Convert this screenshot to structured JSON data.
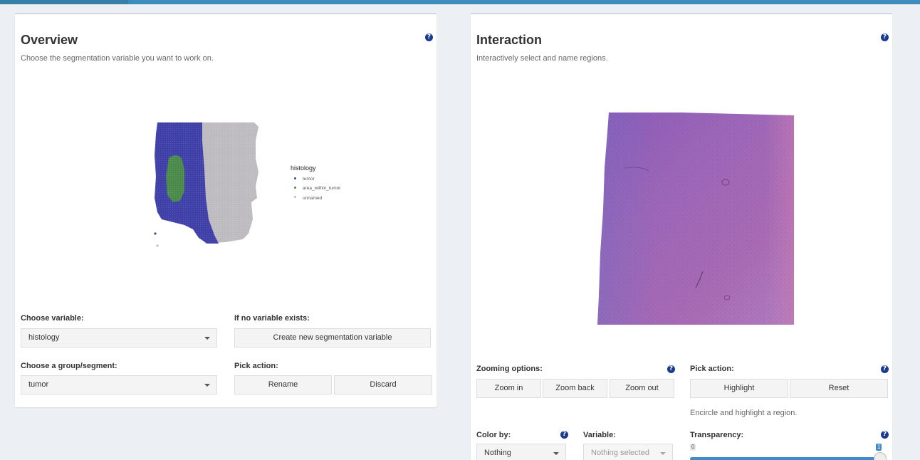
{
  "overview": {
    "title": "Overview",
    "description": "Choose the segmentation variable you want to work on.",
    "help_icon": "?",
    "legend": {
      "title": "histology",
      "items": [
        {
          "label": "tumor",
          "color": "#3f3fa8"
        },
        {
          "label": "area_within_tumor",
          "color": "#4a8a4a"
        },
        {
          "label": "unnamed",
          "color": "#bdbbc0"
        }
      ]
    },
    "choose_variable_label": "Choose variable:",
    "choose_variable_value": "histology",
    "no_variable_label": "If no variable exists:",
    "create_button": "Create new segmentation variable",
    "group_label": "Choose a group/segment:",
    "group_value": "tumor",
    "pick_action_label": "Pick action:",
    "rename_button": "Rename",
    "discard_button": "Discard"
  },
  "interaction": {
    "title": "Interaction",
    "description": "Interactively select and name regions.",
    "help_icon": "?",
    "zoom_label": "Zooming options:",
    "zoom_in": "Zoom in",
    "zoom_back": "Zoom back",
    "zoom_out": "Zoom out",
    "pick_action_label": "Pick action:",
    "highlight_button": "Highlight",
    "reset_button": "Reset",
    "hint": "Encircle and highlight a region.",
    "color_by_label": "Color by:",
    "color_by_value": "Nothing",
    "variable_label": "Variable:",
    "variable_placeholder": "Nothing selected",
    "transparency_label": "Transparency:",
    "transparency_min": "0",
    "transparency_max": "1",
    "transparency_value": 1
  },
  "colors": {
    "accent": "#3c8dbc",
    "tumor": "#3f3fa8",
    "area_within_tumor": "#4a8a4a",
    "unnamed": "#bdbbc0",
    "tissue": "#9a5cb0"
  }
}
